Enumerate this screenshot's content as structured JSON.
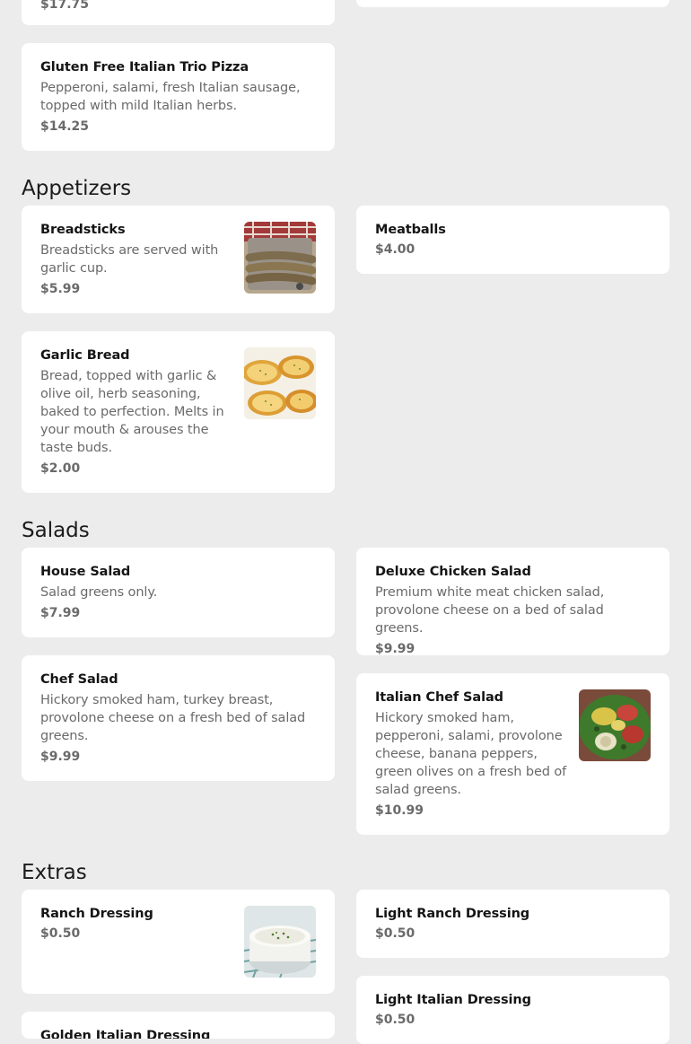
{
  "top_partial": {
    "price": "$17.75"
  },
  "pizza": {
    "gluten_free": {
      "name": "Gluten Free Italian Trio Pizza",
      "desc": "Pepperoni, salami, fresh Italian sausage, topped with mild Italian herbs.",
      "price": "$14.25"
    }
  },
  "appetizers": {
    "title": "Appetizers",
    "breadsticks": {
      "name": "Breadsticks",
      "desc": "Breadsticks are served with garlic cup.",
      "price": "$5.99"
    },
    "meatballs": {
      "name": "Meatballs",
      "price": "$4.00"
    },
    "garlic_bread": {
      "name": "Garlic Bread",
      "desc": "Bread, topped with garlic & olive oil, herb seasoning, baked to perfection. Melts in your mouth & arouses the taste buds.",
      "price": "$2.00"
    }
  },
  "salads": {
    "title": "Salads",
    "house": {
      "name": "House Salad",
      "desc": "Salad greens only.",
      "price": "$7.99"
    },
    "deluxe_chicken": {
      "name": "Deluxe Chicken Salad",
      "desc": "Premium white meat chicken salad, provolone cheese on a bed of salad greens.",
      "price": "$9.99"
    },
    "chef": {
      "name": "Chef Salad",
      "desc": "Hickory smoked ham, turkey breast, provolone cheese on a fresh bed of salad greens.",
      "price": "$9.99"
    },
    "italian_chef": {
      "name": "Italian Chef Salad",
      "desc": "Hickory smoked ham, pepperoni, salami, provolone cheese, banana peppers, green olives on a fresh bed of salad greens.",
      "price": "$10.99"
    }
  },
  "extras": {
    "title": "Extras",
    "ranch": {
      "name": "Ranch Dressing",
      "price": "$0.50"
    },
    "light_ranch": {
      "name": "Light Ranch Dressing",
      "price": "$0.50"
    },
    "light_italian": {
      "name": "Light Italian Dressing",
      "price": "$0.50"
    },
    "golden_italian": {
      "name": "Golden Italian Dressing"
    }
  }
}
